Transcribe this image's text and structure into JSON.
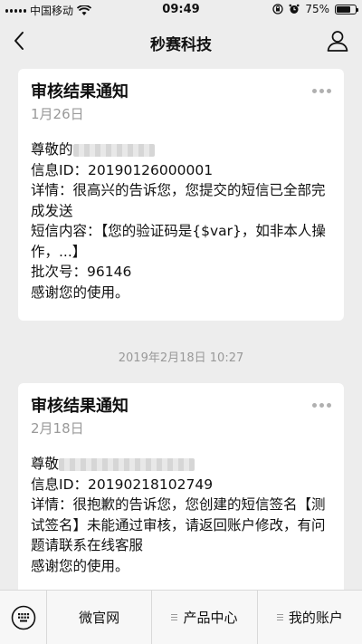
{
  "statusbar": {
    "carrier": "中国移动",
    "time": "09:49",
    "battery": "75%",
    "battery_level": 0.75
  },
  "navbar": {
    "title": "秒赛科技"
  },
  "messages": [
    {
      "title": "审核结果通知",
      "date": "1月26日",
      "greeting": "尊敬的",
      "lines": [
        "信息ID：20190126000001",
        "详情：很高兴的告诉您，您提交的短信已全部完成发送",
        "短信内容：【您的验证码是{$var}，如非本人操作，...】",
        "批次号：96146",
        "感谢您的使用。"
      ]
    },
    {
      "title": "审核结果通知",
      "date": "2月18日",
      "greeting": "尊敬",
      "lines": [
        "信息ID：20190218102749",
        "详情：很抱歉的告诉您，您创建的短信签名【测试签名】未能通过审核，请返回账户修改，有问题请联系在线客服",
        "感谢您的使用。"
      ]
    }
  ],
  "timestamp": "2019年2月18日 10:27",
  "tabbar": {
    "tabs": [
      {
        "label": "微官网",
        "has_menu": false
      },
      {
        "label": "产品中心",
        "has_menu": true
      },
      {
        "label": "我的账户",
        "has_menu": true
      }
    ]
  },
  "icons": {
    "back": "chevron-left-icon",
    "user": "user-icon",
    "more": "more-dots-icon",
    "keyboard": "keyboard-icon",
    "wifi": "wifi-icon",
    "lock": "rotation-lock-icon",
    "alarm": "alarm-icon",
    "battery": "battery-icon"
  }
}
